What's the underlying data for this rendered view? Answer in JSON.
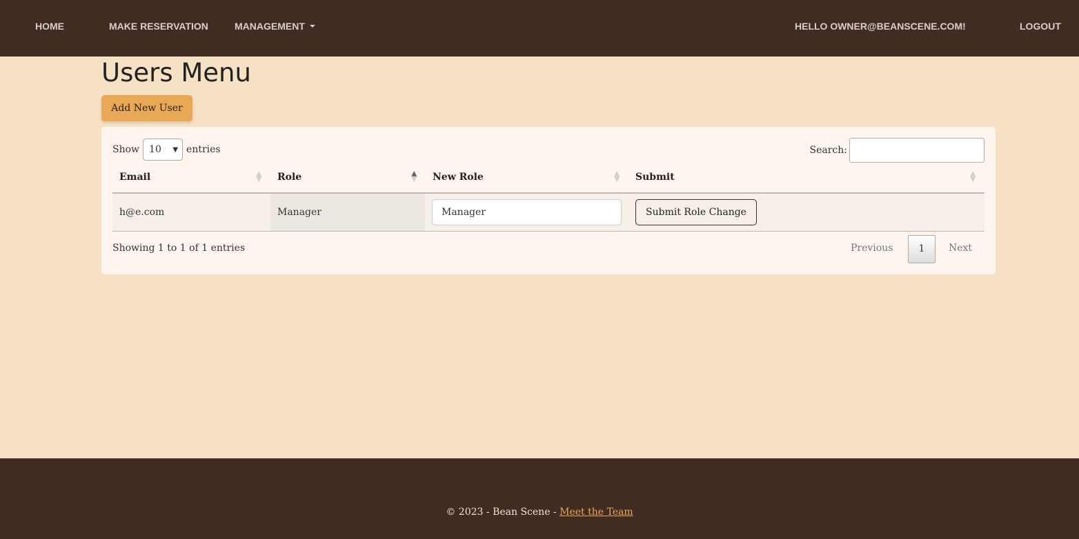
{
  "nav": {
    "home": "HOME",
    "reservation": "MAKE RESERVATION",
    "management": "MANAGEMENT",
    "greeting": "HELLO OWNER@BEANSCENE.COM!",
    "logout": "LOGOUT"
  },
  "page": {
    "title": "Users Menu",
    "add_button": "Add New User"
  },
  "table": {
    "show_label": "Show",
    "entries_label": "entries",
    "page_size": "10",
    "search_label": "Search:",
    "search_value": "",
    "columns": [
      "Email",
      "Role",
      "New Role",
      "Submit"
    ],
    "rows": [
      {
        "email": "h@e.com",
        "role": "Manager",
        "new_role": "Manager",
        "submit": "Submit Role Change"
      }
    ],
    "info": "Showing 1 to 1 of 1 entries",
    "pagination": {
      "previous": "Previous",
      "current": "1",
      "next": "Next"
    }
  },
  "footer": {
    "text": "© 2023 - Bean Scene - ",
    "link": "Meet the Team"
  }
}
